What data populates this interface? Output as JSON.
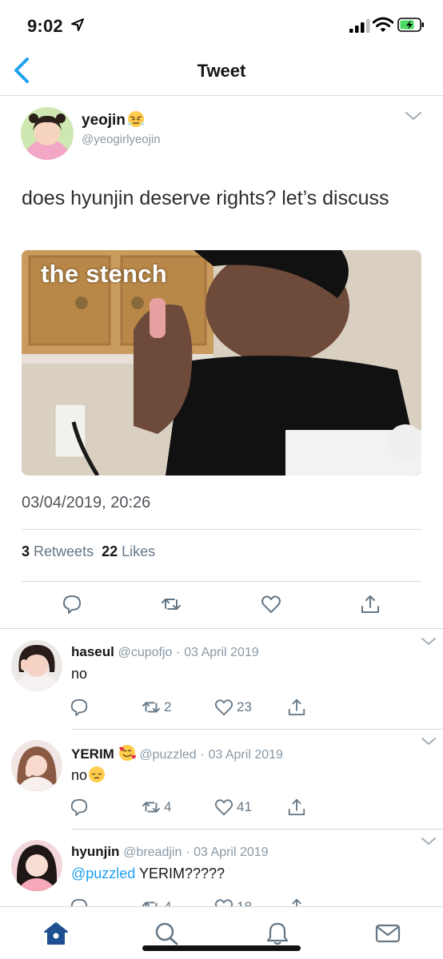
{
  "status_bar": {
    "time": "9:02"
  },
  "nav": {
    "title": "Tweet"
  },
  "main_tweet": {
    "author_name": "yeojin",
    "author_handle": "@yeogirlyeojin",
    "text": "does hyunjin deserve rights? let’s discuss",
    "media_caption": "the stench",
    "timestamp": "03/04/2019, 20:26",
    "retweets": "3",
    "retweets_label": "Retweets",
    "likes": "22",
    "likes_label": "Likes"
  },
  "replies": [
    {
      "name": "haseul",
      "handle": "@cupofjo",
      "date": "03 April 2019",
      "text": "no",
      "retweets": "2",
      "likes": "23"
    },
    {
      "name": "YERIM",
      "handle": "@puzzled",
      "date": "03 April 2019",
      "text": "no",
      "retweets": "4",
      "likes": "41"
    },
    {
      "name": "hyunjin",
      "handle": "@breadjin",
      "date": "03 April 2019",
      "mention": "@puzzled",
      "text": " YERIM?????",
      "retweets": "4",
      "likes": "18"
    }
  ],
  "colors": {
    "accent": "#1da1f2",
    "tab_active": "#1d4f91",
    "muted": "#657786"
  }
}
